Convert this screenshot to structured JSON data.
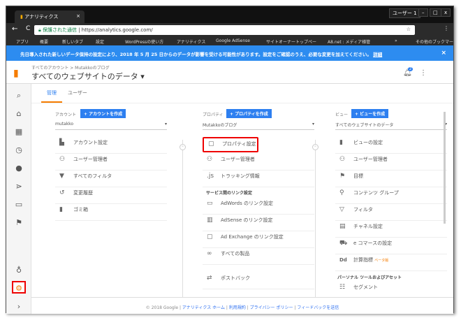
{
  "browser": {
    "tab_title": "アナリティクス",
    "user": "ユーザー 1",
    "secure_label": "保護された通信",
    "url": "https://analytics.google.com/",
    "bookmarks": [
      "アプリ",
      "概要",
      "新しいタブ",
      "設定",
      "WordPressの使い方",
      "アナリティクス",
      "Google AdSense",
      "サイトオーナートップペー",
      "A8.net : メディア様管",
      "»",
      "その他のブックマーク"
    ]
  },
  "banner": {
    "text": "先日導入された新しいデータ保持の設定により、2018 年 5 月 25 日からのデータが影響を受ける可能性があります。設定をご確認のうえ、必要な変更を加えてください。",
    "link": "詳細",
    "close": "×"
  },
  "header": {
    "breadcrumb": "すべてのアカウント > Mutakkoのブログ",
    "title": "すべてのウェブサイトのデータ ▾",
    "notif_count": "2",
    "accent": "#f57c00"
  },
  "tabs": [
    "管理",
    "ユーザー"
  ],
  "account": {
    "label": "アカウント",
    "create": "+ アカウントを作成",
    "selected": "mutakko",
    "items": [
      "アカウント設定",
      "ユーザー管理者",
      "すべてのフィルタ",
      "変更履歴",
      "ゴミ箱"
    ]
  },
  "property": {
    "label": "プロパティ",
    "create": "+ プロパティを作成",
    "selected": "Mutakkoのブログ",
    "items": [
      "プロパティ設定",
      "ユーザー管理者",
      "トラッキング情報"
    ],
    "sub": "サービス間のリンク設定",
    "links": [
      "AdWords のリンク設定",
      "AdSense のリンク設定",
      "Ad Exchange のリンク設定",
      "すべての製品"
    ],
    "postback": "ポストバック"
  },
  "view": {
    "label": "ビュー",
    "create": "+ ビューを作成",
    "selected": "すべてのウェブサイトのデータ",
    "items": [
      "ビューの設定",
      "ユーザー管理者",
      "目標",
      "コンテンツ グループ",
      "フィルタ",
      "チャネル設定",
      "e コマースの設定",
      "計算指標"
    ],
    "beta": "ベータ版",
    "sub": "パーソナル ツールおよびアセット",
    "segment": "セグメント"
  },
  "footer": {
    "copyright": "© 2018 Google |",
    "links": [
      "アナリティクス ホーム",
      "利用規約",
      "プライバシー ポリシー",
      "フィードバックを送信"
    ]
  }
}
